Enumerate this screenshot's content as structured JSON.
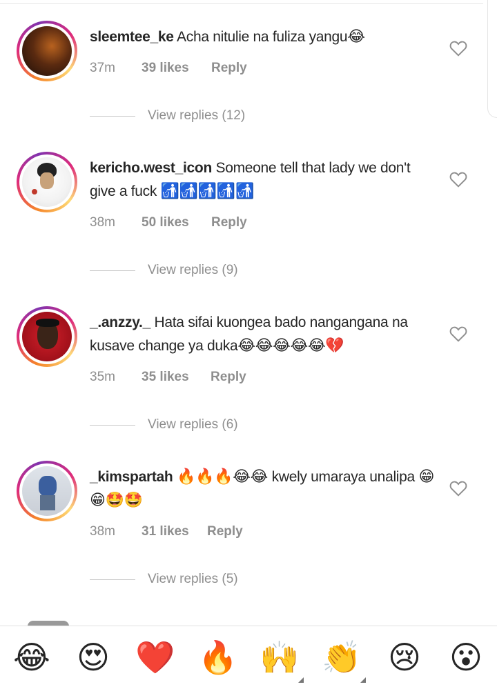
{
  "comments": [
    {
      "username": "sleemtee_ke",
      "text": "Acha nitulie na fuliza yangu",
      "emojis": "😂",
      "time": "37m",
      "likes": "39 likes",
      "reply": "Reply",
      "view_replies": "View replies (12)"
    },
    {
      "username": "kericho.west_icon",
      "text": "Someone tell that lady we don't give a fuck",
      "emojis": "🚮🚮🚮🚮🚮",
      "time": "38m",
      "likes": "50 likes",
      "reply": "Reply",
      "view_replies": "View replies (9)"
    },
    {
      "username": "_.anzzy._",
      "text": "Hata sifai kuongea bado nangangana na kusave change ya duka",
      "emojis": "😂😂😂😂😂💔",
      "time": "35m",
      "likes": "35 likes",
      "reply": "Reply",
      "view_replies": "View replies (6)"
    },
    {
      "username": "_kimspartah",
      "text_before": "🔥🔥🔥😂😂",
      "text": "kwely umaraya unalipa",
      "emojis": "😁😁🤩🤩",
      "time": "38m",
      "likes": "31 likes",
      "reply": "Reply",
      "view_replies": "View replies (5)"
    }
  ],
  "reaction_bar": [
    "😂",
    "😍",
    "❤️",
    "🔥",
    "🙌",
    "👏",
    "😢",
    "😮"
  ],
  "colors": {
    "text": "#262626",
    "muted": "#8e8e8e",
    "heart_outline": "#8e8e8e"
  }
}
